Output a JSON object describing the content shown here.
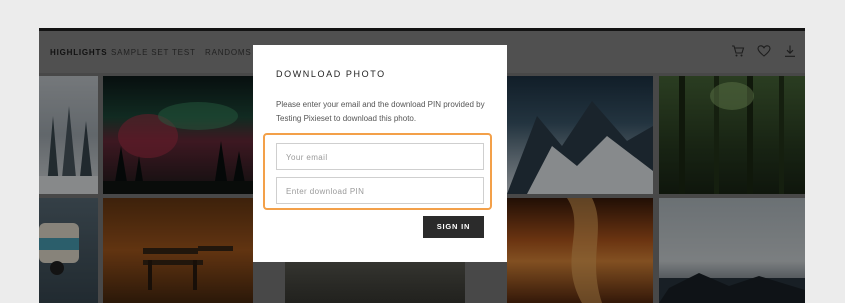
{
  "nav": {
    "items": [
      {
        "label": "HIGHLIGHTS",
        "active": true
      },
      {
        "label": "SAMPLE SET",
        "active": false
      },
      {
        "label": "TEST",
        "active": false
      },
      {
        "label": "RANDOMS",
        "active": false
      }
    ],
    "icons": [
      "cart-icon",
      "heart-icon",
      "download-icon"
    ]
  },
  "modal": {
    "title": "DOWNLOAD PHOTO",
    "description": "Please enter your email and the download PIN provided by Testing Pixieset to download this photo.",
    "email_placeholder": "Your email",
    "pin_placeholder": "Enter download PIN",
    "signin_label": "SIGN IN"
  },
  "colors": {
    "highlight": "#f3a049",
    "button": "#2b2b2b"
  }
}
